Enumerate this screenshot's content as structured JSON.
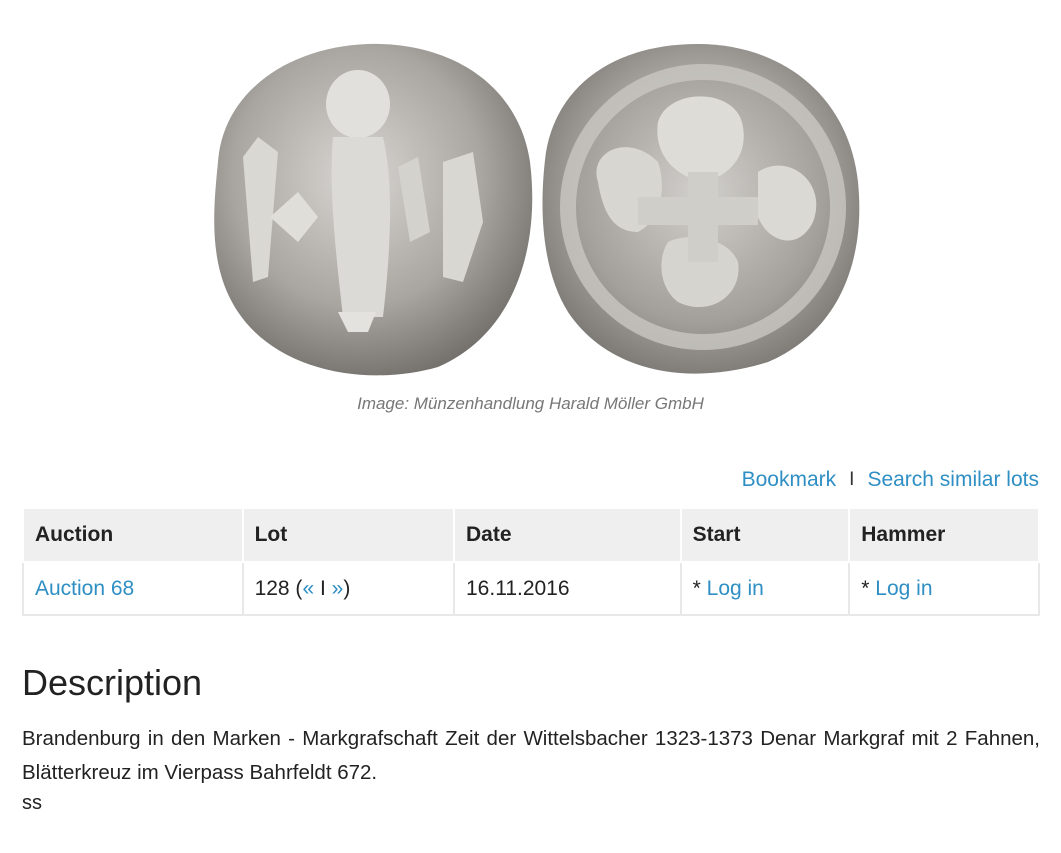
{
  "image": {
    "alt": "Coin obverse and reverse",
    "caption": "Image: Münzenhandlung Harald Möller GmbH"
  },
  "actions": {
    "bookmark_label": "Bookmark",
    "separator": "I",
    "search_similar_label": "Search similar lots"
  },
  "table": {
    "headers": [
      "Auction",
      "Lot",
      "Date",
      "Start",
      "Hammer"
    ],
    "row": {
      "auction": "Auction 68",
      "lot_number": "128 (",
      "lot_prev": "«",
      "lot_sep": " I ",
      "lot_next": "»",
      "lot_close": ")",
      "date": "16.11.2016",
      "start_prefix": "* ",
      "start_link": "Log in",
      "hammer_prefix": "* ",
      "hammer_link": "Log in"
    }
  },
  "description": {
    "title": "Description",
    "text": "Brandenburg in den Marken - Markgrafschaft Zeit der Wittelsbacher 1323-1373 Denar Markgraf mit 2 Fahnen, Blätterkreuz im Vierpass Bahrfeldt 672.",
    "grade": "ss"
  },
  "colors": {
    "link": "#2f8fc4",
    "header_bg": "#efefef",
    "coin_silver": "#b9b6b1"
  }
}
